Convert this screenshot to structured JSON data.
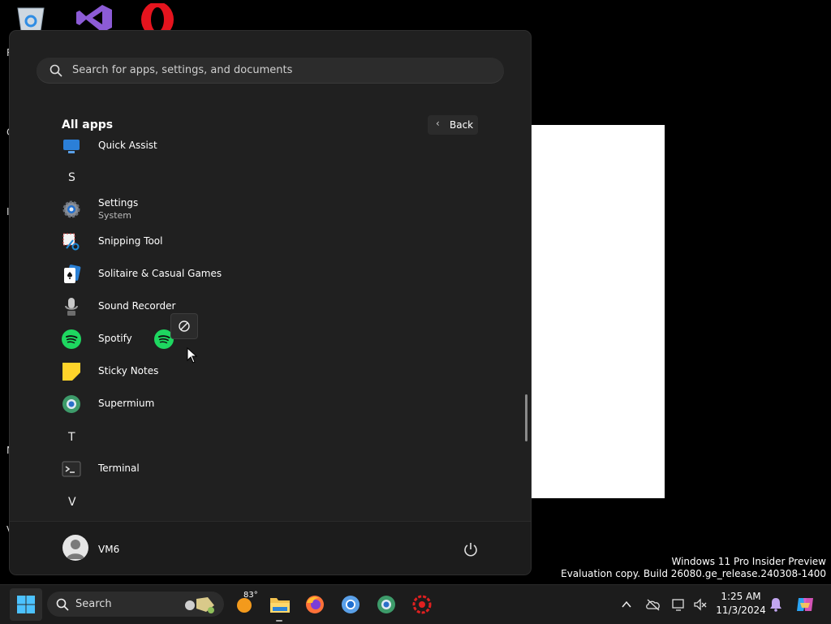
{
  "desktop": {
    "letters": [
      "R",
      "C",
      "I",
      "N",
      "V"
    ],
    "watermark_line1": "Windows 11 Pro Insider Preview",
    "watermark_line2": "Evaluation copy. Build 26080.ge_release.240308-1400"
  },
  "start_menu": {
    "search_placeholder": "Search for apps, settings, and documents",
    "all_apps_title": "All apps",
    "back_label": "Back",
    "apps": [
      {
        "name": "Quick Assist",
        "icon": "quick-assist-icon"
      },
      {
        "letter": "S"
      },
      {
        "name": "Settings",
        "subtitle": "System",
        "icon": "settings-gear-icon"
      },
      {
        "name": "Snipping Tool",
        "icon": "snipping-tool-icon"
      },
      {
        "name": "Solitaire & Casual Games",
        "icon": "solitaire-icon"
      },
      {
        "name": "Sound Recorder",
        "icon": "microphone-icon"
      },
      {
        "name": "Spotify",
        "icon": "spotify-icon"
      },
      {
        "name": "Sticky Notes",
        "icon": "sticky-notes-icon"
      },
      {
        "name": "Supermium",
        "icon": "supermium-icon"
      },
      {
        "letter": "T"
      },
      {
        "name": "Terminal",
        "icon": "terminal-icon"
      },
      {
        "letter": "V"
      }
    ],
    "user_name": "VM6"
  },
  "taskbar": {
    "search_label": "Search",
    "weather_temp": "83°",
    "clock_time": "1:25 AM",
    "clock_date": "11/3/2024"
  },
  "colors": {
    "spotify_green": "#1ed760",
    "taskbar_bg": "#1c1c1c",
    "menu_bg": "#202020"
  }
}
